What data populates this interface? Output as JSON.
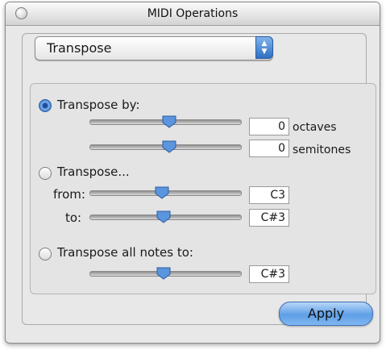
{
  "window": {
    "title": "MIDI Operations"
  },
  "operation_popup": {
    "selected": "Transpose"
  },
  "transpose_by": {
    "label": "Transpose by:",
    "selected": true,
    "octaves": {
      "value": "0",
      "unit": "octaves"
    },
    "semitones": {
      "value": "0",
      "unit": "semitones"
    }
  },
  "transpose_range": {
    "label": "Transpose...",
    "selected": false,
    "from": {
      "label": "from:",
      "value": "C3"
    },
    "to": {
      "label": "to:",
      "value": "C#3"
    }
  },
  "transpose_all": {
    "label": "Transpose all notes to:",
    "selected": false,
    "value": "C#3"
  },
  "apply_button": {
    "label": "Apply"
  }
}
